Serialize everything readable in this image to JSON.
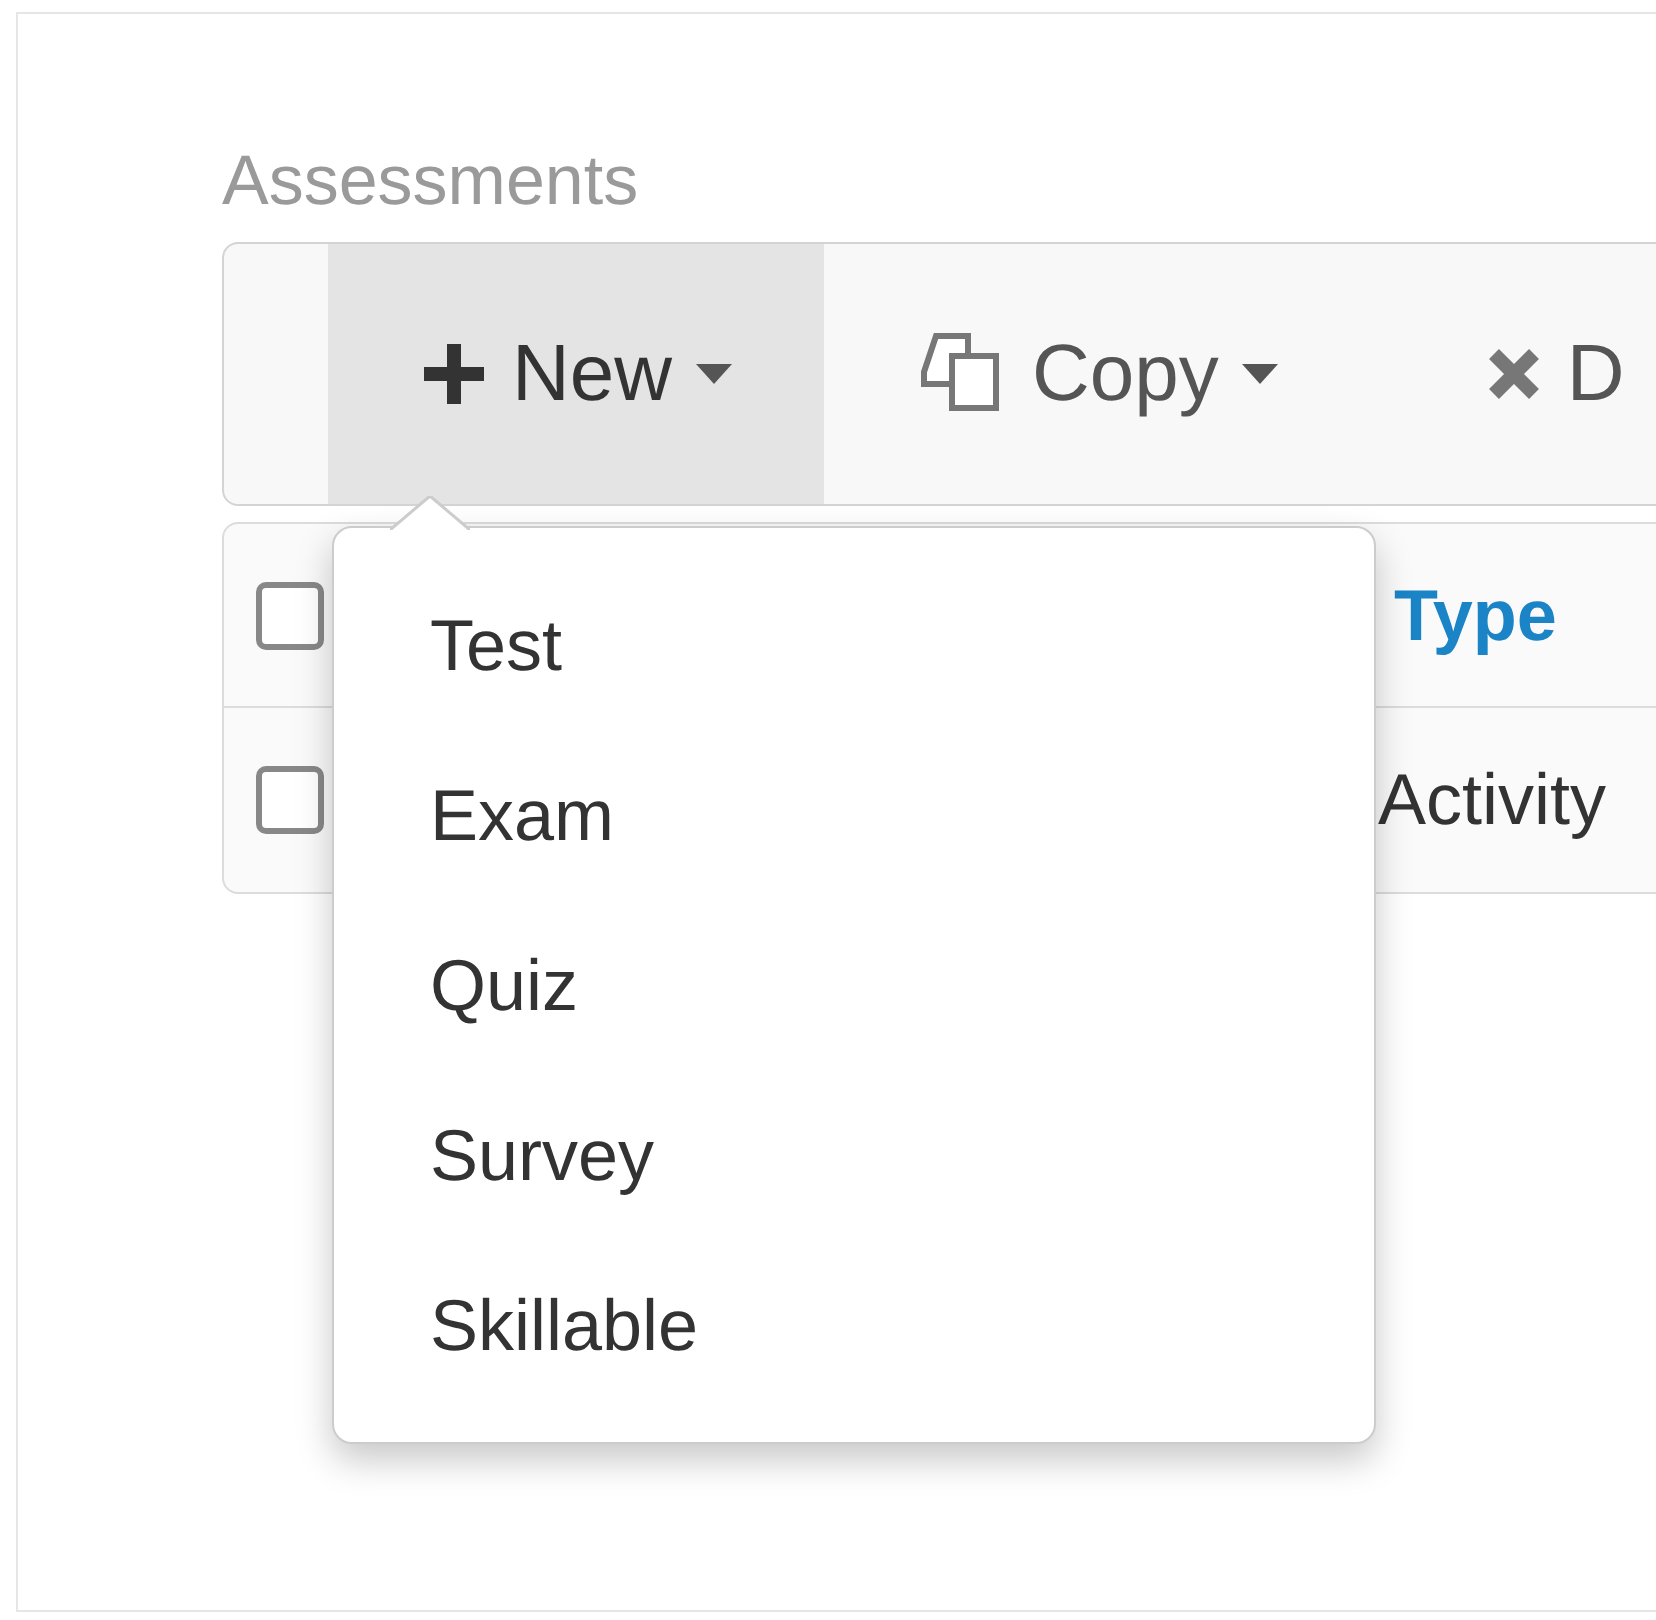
{
  "section_title": "Assessments",
  "toolbar": [
    {
      "label": "New",
      "kind": "plus",
      "dropdown": true,
      "selected": true
    },
    {
      "label": "Copy",
      "kind": "copy",
      "dropdown": true,
      "selected": false
    },
    {
      "label": "D",
      "kind": "delete",
      "dropdown": false,
      "selected": false
    }
  ],
  "table": {
    "header_checked": false,
    "columns": [
      "Type"
    ],
    "rows": [
      {
        "checked": false,
        "cells": [
          "Activity"
        ]
      }
    ]
  },
  "menu": {
    "open": true,
    "items": [
      "Test",
      "Exam",
      "Quiz",
      "Survey",
      "Skillable"
    ]
  }
}
